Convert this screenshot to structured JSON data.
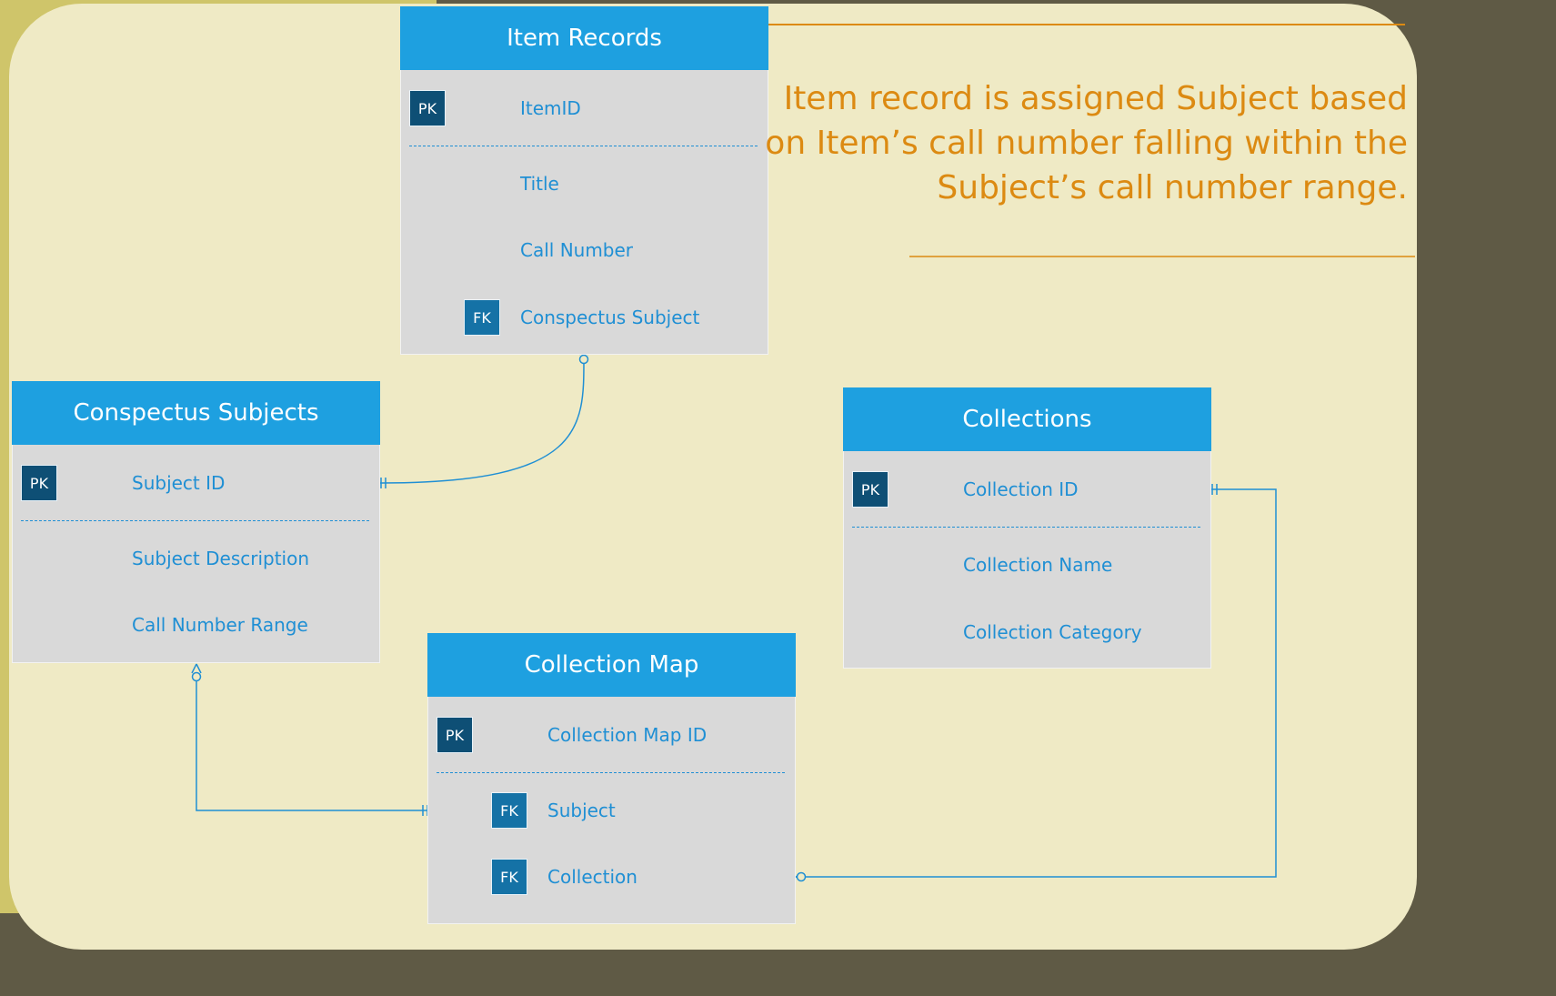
{
  "entities": {
    "item_records": {
      "title": "Item Records",
      "pk_badge": "PK",
      "pk_field": "ItemID",
      "fields": [
        "Title",
        "Call Number"
      ],
      "fk_badge": "FK",
      "fk_field": "Conspectus Subject"
    },
    "conspectus_subjects": {
      "title": "Conspectus Subjects",
      "pk_badge": "PK",
      "pk_field": "Subject ID",
      "fields": [
        "Subject Description",
        "Call Number Range"
      ]
    },
    "collections": {
      "title": "Collections",
      "pk_badge": "PK",
      "pk_field": "Collection ID",
      "fields": [
        "Collection Name",
        "Collection Category"
      ]
    },
    "collection_map": {
      "title": "Collection Map",
      "pk_badge": "PK",
      "pk_field": "Collection Map ID",
      "fk_badge": "FK",
      "fk_fields": [
        "Subject",
        "Collection"
      ]
    }
  },
  "annotation": {
    "lines": [
      "Item record is assigned Subject based",
      "on Item’s call number falling within the",
      "Subject’s call number range."
    ]
  },
  "colors": {
    "header": "#1ea0e0",
    "body": "#d9d9d9",
    "text": "#1f8fd4",
    "pk_badge": "#0e4f75",
    "fk_badge": "#1572a6",
    "annotation": "#dc8a12",
    "panel": "#efeac5"
  }
}
